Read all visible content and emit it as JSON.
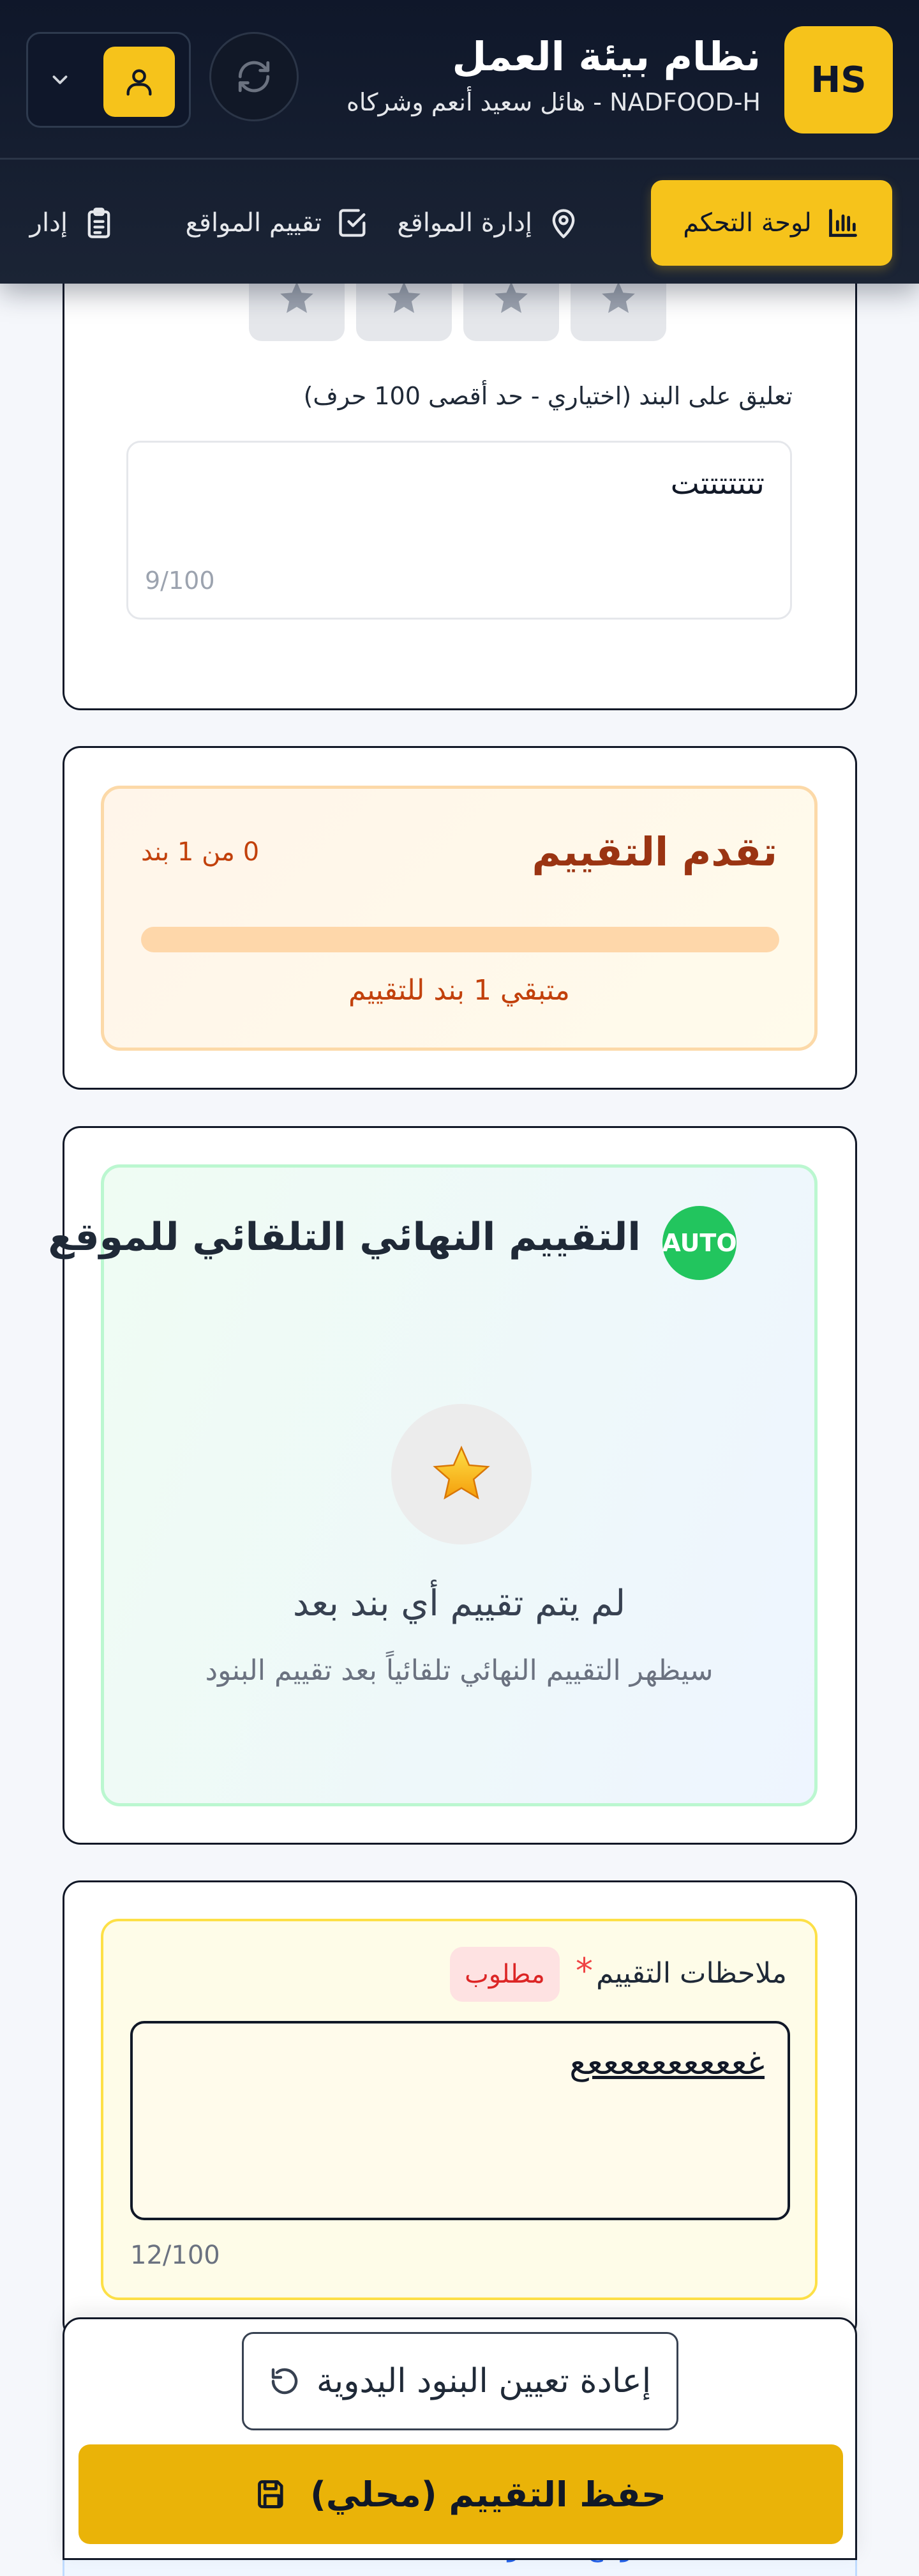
{
  "header": {
    "logo_initials": "HS",
    "title": "نظام بيئة العمل",
    "subtitle": "NADFOOD-H - هائل سعيد أنعم وشركاه"
  },
  "nav": {
    "items": [
      {
        "label": "لوحة التحكم",
        "icon": "bar-chart-icon",
        "active": true
      },
      {
        "label": "إدارة المواقع",
        "icon": "map-pin-icon",
        "active": false
      },
      {
        "label": "تقييم المواقع",
        "icon": "check-square-icon",
        "active": false
      },
      {
        "label": "إدار",
        "icon": "clipboard-icon",
        "active": false
      }
    ]
  },
  "criterion": {
    "comment_label": "تعليق على البند (اختياري - حد أقصى 100 حرف)",
    "comment_value": "تتتتتتتت",
    "comment_count": "9/100",
    "star_count": 4
  },
  "progress": {
    "title": "تقدم التقييم",
    "count_text": "0 من 1 بند",
    "fraction": 0,
    "remaining_text": "متبقي 1 بند للتقييم"
  },
  "auto_rating": {
    "title": "التقييم النهائي التلقائي للموقع",
    "badge": "AUTO",
    "empty_title": "لم يتم تقييم أي بند بعد",
    "empty_hint": "سيظهر التقييم النهائي تلقائياً بعد تقييم البنود"
  },
  "notes": {
    "label": "ملاحظات التقييم",
    "required_mark": "*",
    "required_badge": "مطلوب",
    "value": "غععععععععععع",
    "count": "12/100"
  },
  "actions": {
    "reset_label": "إعادة تعيين البنود اليدوية",
    "save_label": "حفظ التقييم (محلي)"
  },
  "footer_peek": {
    "text": "المواقع المحفوظة: 10"
  },
  "colors": {
    "brand_yellow": "#f6c31b",
    "header_dark": "#0f172a",
    "progress_orange": "#c2410c",
    "auto_green": "#22c55e",
    "required_red": "#dc2626",
    "save_button": "#eab308"
  }
}
